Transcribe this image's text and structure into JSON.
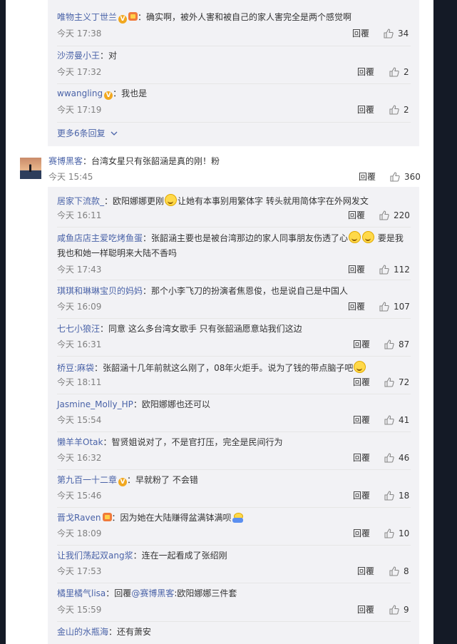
{
  "nested_top": [
    {
      "user": "唯物主义丁世兰",
      "badges": [
        "vip",
        "gift"
      ],
      "text": "确实啊，被外人害和被自己的家人害完全是两个感觉啊",
      "time": "今天 17:38",
      "reply": "回覆",
      "likes": "34"
    },
    {
      "user": "沙涝曼小王",
      "badges": [],
      "text": "对",
      "time": "今天 17:32",
      "reply": "回覆",
      "likes": "2"
    },
    {
      "user": "wwangling",
      "badges": [
        "vip"
      ],
      "text": "我也是",
      "time": "今天 17:19",
      "reply": "回覆",
      "likes": "2"
    }
  ],
  "more_replies": "更多6条回复",
  "main_comment": {
    "user": "赛博黑客",
    "text": "台湾女星只有张韶涵是真的刚！粉",
    "time": "今天 15:45",
    "reply": "回覆",
    "likes": "360"
  },
  "replies": [
    {
      "user": "居家下流款_",
      "text1": "欧阳娜娜更刚",
      "text2": "让她有本事别用繁体字 转头就用简体字在外网发文",
      "time": "今天 16:11",
      "reply": "回覆",
      "likes": "220"
    },
    {
      "user": "咸鱼店店主爱吃烤鱼蛋",
      "text1": "张韶涵主要也是被台湾那边的家人同事朋友伤透了心",
      "text2": "要是我",
      "line2": "我也和她一样聪明来大陆不香吗",
      "time": "今天 17:43",
      "reply": "回覆",
      "likes": "112"
    },
    {
      "user": "琪琪和琳琳宝贝的妈妈",
      "text": "那个小李飞刀的扮演者焦恩俊，也是说自己是中国人",
      "time": "今天 16:09",
      "reply": "回覆",
      "likes": "107"
    },
    {
      "user": "七七小狼汪",
      "text": "同意 这么多台湾女歌手 只有张韶涵愿意站我们这边",
      "time": "今天 16:31",
      "reply": "回覆",
      "likes": "87"
    },
    {
      "user": "桥豆:麻袋",
      "text": "张韶涵十几年前就这么刚了，08年火炬手。说为了钱的带点脑子吧",
      "time": "今天 18:11",
      "reply": "回覆",
      "likes": "72"
    },
    {
      "user": "Jasmine_Molly_HP",
      "text": "欧阳娜娜也还可以",
      "time": "今天 15:54",
      "reply": "回覆",
      "likes": "41"
    },
    {
      "user": "懒羊羊Otak",
      "text": "智贤姐说对了，不是官打压，完全是民间行为",
      "time": "今天 16:32",
      "reply": "回覆",
      "likes": "46"
    },
    {
      "user": "第九百一十二章",
      "text": "早就粉了 不会错",
      "time": "今天 15:46",
      "reply": "回覆",
      "likes": "18"
    },
    {
      "user": "晋戈Raven",
      "text": "因为她在大陆赚得盆满钵满呗",
      "time": "今天 18:09",
      "reply": "回覆",
      "likes": "10"
    },
    {
      "user": "让我们荡起双ang浆",
      "text": "连在一起看成了张绍刚",
      "time": "今天 17:53",
      "reply": "回覆",
      "likes": "8"
    },
    {
      "user": "橘里橘气lisa",
      "text_prefix": "回覆",
      "mention": "@赛博黑客",
      "text": ":欧阳娜娜三件套",
      "time": "今天 15:59",
      "reply": "回覆",
      "likes": "9"
    },
    {
      "user": "金山的水瓶海",
      "text": "还有萧安",
      "time": "",
      "reply": "",
      "likes": ""
    }
  ]
}
